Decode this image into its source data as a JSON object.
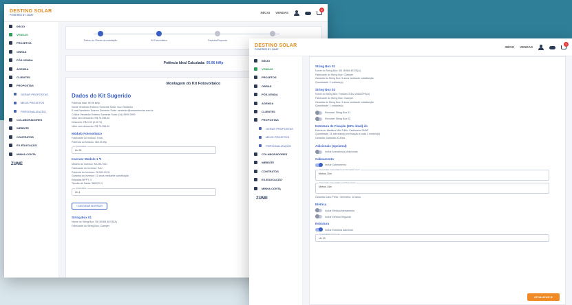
{
  "brand": {
    "line1": "DESTINO SOLAR",
    "line2": "POWERED BY ZUME"
  },
  "topnav": {
    "link1": "INÍCIO",
    "link2": "VENDAS",
    "cart_count": "2"
  },
  "sidebar1": [
    {
      "label": "Início",
      "icon": "home-icon"
    },
    {
      "label": "Vendas",
      "icon": "dollar-icon",
      "active": true
    },
    {
      "label": "Projetos",
      "icon": "chart-icon"
    },
    {
      "label": "Obras",
      "icon": "tools-icon"
    },
    {
      "label": "Pós-venda",
      "icon": "handshake-icon"
    },
    {
      "label": "Agenda",
      "icon": "calendar-icon"
    },
    {
      "label": "Clientes",
      "icon": "users-icon"
    },
    {
      "label": "Propostas",
      "icon": "list-icon"
    },
    {
      "label": "Gerar propostas",
      "icon": "doc-icon",
      "sub": true
    },
    {
      "label": "Meus projetos",
      "icon": "folder-icon",
      "sub": true
    },
    {
      "label": "Personalização",
      "icon": "brush-icon",
      "sub": true
    },
    {
      "label": "Colaboradores",
      "icon": "team-icon"
    },
    {
      "label": "Website",
      "icon": "globe-icon"
    },
    {
      "label": "Contratos",
      "icon": "contract-icon"
    },
    {
      "label": "Ex-educação",
      "icon": "book-icon"
    },
    {
      "label": "Minha conta",
      "icon": "account-icon"
    }
  ],
  "zume_logo": "ZUME",
  "stepper": [
    "Dados do Cliente da Instalação",
    "Kit Fotovoltaico",
    "Revisão/Proposta",
    ""
  ],
  "power": {
    "label": "Potência Ideal Calculada:",
    "value": "95.96 kWp"
  },
  "kit": {
    "heading": "Montagem do Kit Fotovoltaico",
    "title": "Dados do Kit Sugerido",
    "lines": [
      "Potência total: 95.96 kWp",
      "Nome Vendedor Externo Somente Solar: Sou Vendedor",
      "E-mail Vendedor Externo Somente Solar: vendedor@somentesolar.com.br",
      "Celular Vendedor Externo Somente Solar: (34) 9999-9999",
      "Valor sem desconto: R$ 75.258,00",
      "Desconto: R$ 0.00 (0.00 %)",
      "Valor com desconto: R$ 75.258,00"
    ],
    "module_title": "Módulo Fotovoltaico",
    "module_lines": [
      "Fabricante do módulo: Trina",
      "Potência do Módulo: 360.00 Wp"
    ],
    "module_field_label": "Quantidade",
    "module_field_value": "Un 31",
    "inverter_title": "Inversor Modelo 1",
    "inverter_lines": [
      "Modelo do Inversor: MI-2M-75-D",
      "Fabricante do Inversor: SAJ",
      "Potência do Inversor: 28.500,00 W",
      "Garantia do Inversor: 10 anos mediante substituição",
      "Entradas MPPT: 3",
      "Tensão de Saída: 380/220 V"
    ],
    "inverter_field_label": "Quantidade",
    "inverter_field_value": "Un 1",
    "add_inverter": "+ ADICIONAR INVERSOR",
    "stringbox_title": "String Box 01",
    "stringbox_lines": [
      "Nome do String Box: SB 1E/6M 4E/2S(A)",
      "Fabricante do String Box: Clamper"
    ]
  },
  "win2": {
    "sb01_title": "String Box 01",
    "sb01_lines": [
      "Nome do String Box: SB 1E/6M 4E/2S(A)",
      "Fabricante do String Box: Clamper",
      "Garantia do String Box: 5 anos mediante substituição",
      "Quantidade: 2 unidade(s)"
    ],
    "sb02_title": "String Box 02",
    "sb02_lines": [
      "Nome do String Box: Fortidec 2/3x2 20kA DPS(A)",
      "Fabricante do String Box: Clamper",
      "Garantia do String Box: 5 anos mediante substituição",
      "Quantidade: 1 unidade(s)"
    ],
    "toggle_rm1": "Remover String Box 01",
    "toggle_rm2": "Remover String Box 02",
    "struct_title": "Estrutura de Fixação (60% ideal) do",
    "struct_lines": [
      "Estrutura: Metálica Mini Trilho, Fabricante SMHF",
      "Quantidade: 31 estrutura(s) em fixação a cada 3 módulo(s)",
      "Garantia: Garantia 20 anos"
    ],
    "extra_title": "Adicionais (opcional)",
    "toggle_extra": "Incluir Acessório(s) Adicionais",
    "cable_title": "Cabeamento",
    "toggle_cable": "Incluir Cabeamento",
    "cable_f1_label": "Total Cabo Fotovoltaico (m) Vermelho 6mm²",
    "cable_f1_value": "Metros 10m",
    "cable_f2_label": "Total Cabo Fotovoltaico (m) Preto 6mm²",
    "cable_f2_value": "Metros 10m",
    "cable_note": "Garantia Cabo Preto / Vermelho: 10 anos",
    "elec_title": "Elétrica",
    "toggle_e1": "Incluir Elétrica Aterramento",
    "toggle_e2": "Incluir Elétrica Segundo",
    "struct2_title": "Estrutura",
    "toggle_s1": "Incluir Estrutura Adicional",
    "s_field_label": "Quantidade Estruturas",
    "s_field_value": "Un 10",
    "update_btn": "ATUALIZAR"
  }
}
